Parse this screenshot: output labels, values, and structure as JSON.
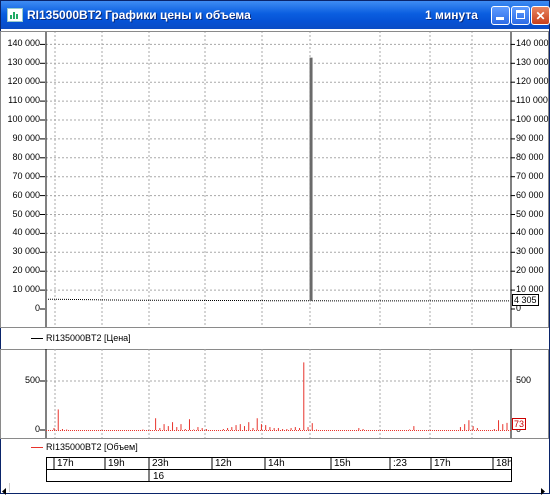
{
  "window": {
    "title": "RI135000BT2 Графики цены и объема",
    "interval": "1 минута",
    "buttons": {
      "minimize": "_",
      "maximize": "□",
      "close": "✕"
    }
  },
  "price_panel": {
    "y_ticks": [
      "140 000",
      "130 000",
      "120 000",
      "110 000",
      "100 000",
      "90 000",
      "80 000",
      "70 000",
      "60 000",
      "50 000",
      "40 000",
      "30 000",
      "20 000",
      "10 000",
      "0"
    ],
    "last_value": "4 305",
    "legend": "RI135000BT2 [Цена]",
    "colors": {
      "line": "#000000",
      "spike": "#6a6a6a"
    }
  },
  "volume_panel": {
    "y_ticks": [
      "500",
      "0"
    ],
    "last_value": "73",
    "legend": "RI135000BT2 [Объем]",
    "colors": {
      "bars": "#e8332b"
    }
  },
  "time_axis": {
    "labels": [
      "17h",
      "19h",
      "23h",
      "12h",
      "14h",
      "15h",
      ":23",
      "17h",
      "18h"
    ],
    "date": "16"
  },
  "chart_data": [
    {
      "type": "line",
      "title": "",
      "ylabel": "",
      "ylim": [
        0,
        145000
      ],
      "series": [
        {
          "name": "RI135000BT2 [Цена]",
          "values": [
            5200,
            5100,
            4950,
            4800,
            4700,
            4650,
            4600,
            4580,
            4550,
            4500,
            4480,
            4450,
            4400,
            4380,
            4350,
            4330,
            4300,
            4300,
            4290,
            4280,
            4300,
            4310,
            4320,
            4300,
            4290,
            4305
          ]
        }
      ],
      "spike": {
        "value": 133000,
        "position_fraction": 0.57
      },
      "last_value": 4305
    },
    {
      "type": "bar",
      "title": "",
      "ylabel": "",
      "ylim": [
        0,
        800
      ],
      "series": [
        {
          "name": "RI135000BT2 [Объем]",
          "values": [
            20,
            210,
            10,
            5,
            0,
            0,
            0,
            0,
            0,
            0,
            0,
            0,
            0,
            0,
            0,
            0,
            0,
            0,
            0,
            0,
            0,
            5,
            0,
            0,
            120,
            20,
            60,
            40,
            80,
            30,
            60,
            10,
            110,
            5,
            30,
            20,
            10,
            0,
            0,
            0,
            10,
            20,
            30,
            50,
            60,
            40,
            80,
            20,
            120,
            60,
            50,
            30,
            20,
            20,
            10,
            10,
            20,
            30,
            20,
            690,
            30,
            70,
            5,
            0,
            0,
            0,
            0,
            0,
            0,
            0,
            0,
            0,
            20,
            10,
            0,
            0,
            0,
            0,
            0,
            0,
            0,
            0,
            0,
            0,
            5,
            40,
            0,
            0,
            0,
            0,
            0,
            0,
            0,
            0,
            0,
            0,
            30,
            60,
            100,
            40,
            20,
            0,
            0,
            0,
            10,
            100,
            60,
            73
          ]
        }
      ],
      "last_value": 73
    }
  ]
}
